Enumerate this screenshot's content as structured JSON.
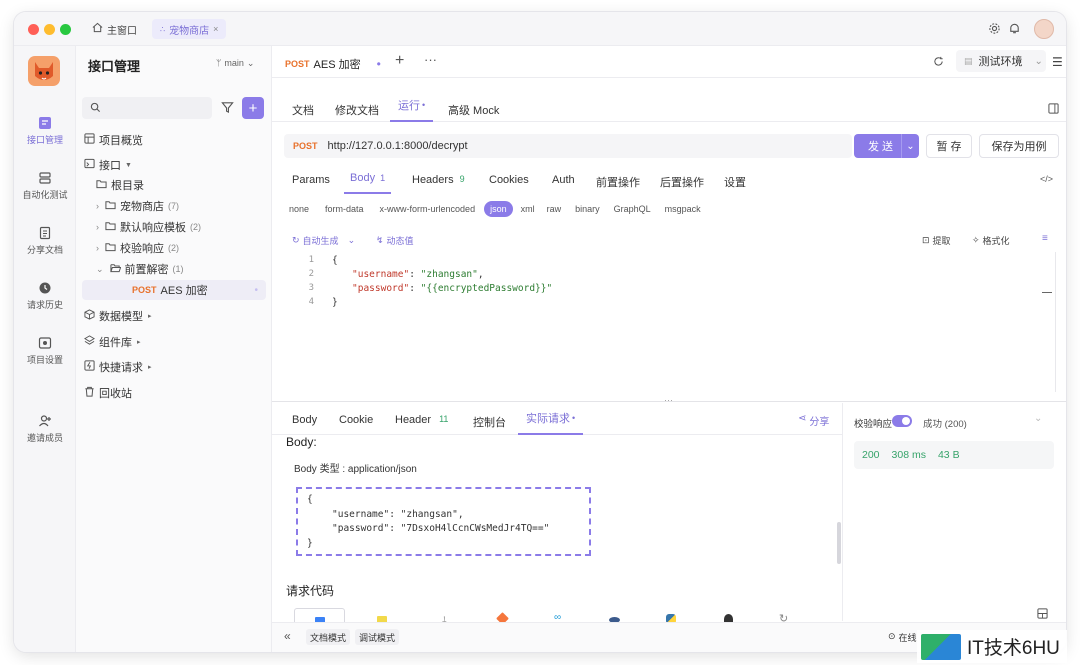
{
  "titlebar": {
    "tab_home": "主窗口",
    "tab_project": "宠物商店"
  },
  "rail": {
    "items": [
      {
        "label": "接口管理"
      },
      {
        "label": "自动化测试"
      },
      {
        "label": "分享文档"
      },
      {
        "label": "请求历史"
      },
      {
        "label": "项目设置"
      },
      {
        "label": "邀请成员"
      }
    ]
  },
  "tree": {
    "title": "接口管理",
    "branch": "main",
    "items": {
      "overview": "项目概览",
      "api": "接口",
      "root": "根目录",
      "pet": "宠物商店",
      "pet_count": "(7)",
      "default_tpl": "默认响应模板",
      "default_tpl_count": "(2)",
      "check": "校验响应",
      "check_count": "(2)",
      "pre": "前置解密",
      "pre_count": "(1)",
      "active_method": "POST",
      "active_name": "AES 加密",
      "models": "数据模型",
      "components": "组件库",
      "quick": "快捷请求",
      "trash": "回收站"
    }
  },
  "header": {
    "method": "POST",
    "name": "AES 加密",
    "env": "测试环境"
  },
  "subtabs": [
    "文档",
    "修改文档",
    "运行",
    "高级 Mock"
  ],
  "request": {
    "method": "POST",
    "url": "http://127.0.0.1:8000/decrypt",
    "send": "发 送",
    "save": "暂 存",
    "save_case": "保存为用例"
  },
  "param_tabs": {
    "params": "Params",
    "body": "Body",
    "body_count": "1",
    "headers": "Headers",
    "headers_count": "9",
    "cookies": "Cookies",
    "auth": "Auth",
    "pre": "前置操作",
    "post": "后置操作",
    "settings": "设置"
  },
  "body_types": [
    "none",
    "form-data",
    "x-www-form-urlencoded",
    "json",
    "xml",
    "raw",
    "binary",
    "GraphQL",
    "msgpack"
  ],
  "editor_tools": {
    "auto_gen": "自动生成",
    "dynamic": "动态值",
    "extract": "提取",
    "format": "格式化"
  },
  "code": {
    "lines": [
      "1",
      "2",
      "3",
      "4"
    ],
    "l1": "{",
    "l2_key": "\"username\"",
    "l2_val": "\"zhangsan\"",
    "l3_key": "\"password\"",
    "l3_val": "\"{{encryptedPassword}}\"",
    "l4": "}"
  },
  "response_tabs": {
    "body": "Body",
    "cookie": "Cookie",
    "header": "Header",
    "header_count": "11",
    "console": "控制台",
    "actual": "实际请求",
    "share": "分享"
  },
  "actual": {
    "heading": "Body:",
    "type_label": "Body 类型 : application/json",
    "l1": "{",
    "l2": "\"username\": \"zhangsan\",",
    "l3": "\"password\": \"7DsxoH4lCcnCWsMedJr4TQ==\"",
    "l4": "}",
    "code_heading": "请求代码"
  },
  "status": {
    "validate": "校验响应",
    "success": "成功 (200)",
    "code": "200",
    "time": "308 ms",
    "size": "43 B"
  },
  "footer": {
    "doc_mode": "文档模式",
    "debug_mode": "调试模式",
    "online": "在线"
  },
  "watermark": "IT技术6HU",
  "colors": {
    "accent": "#8b7be8",
    "post": "#e8712b",
    "success_text": "#36a36a"
  }
}
